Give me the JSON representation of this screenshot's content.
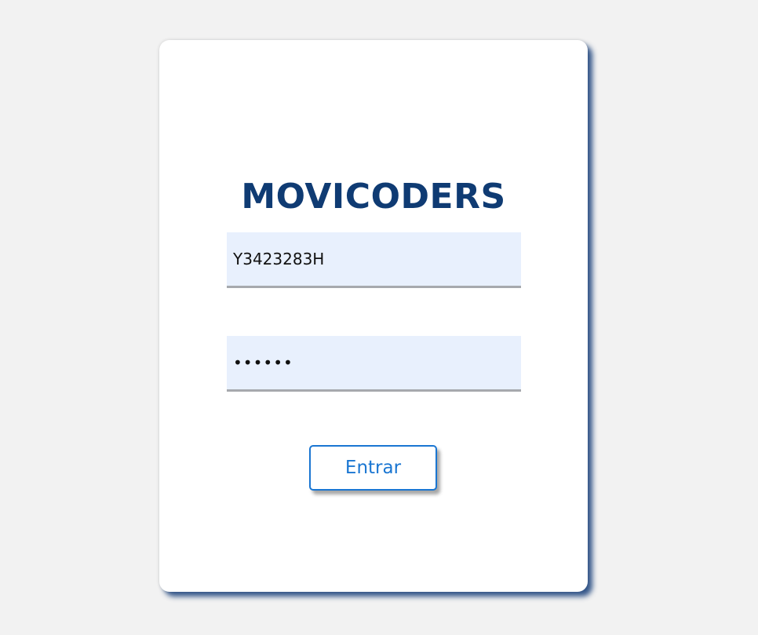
{
  "login": {
    "brand": "MOVICODERS",
    "username_value": "Y3423283H",
    "password_value": "123456",
    "submit_label": "Entrar"
  },
  "colors": {
    "background": "#f2f2f2",
    "brand": "#0f3b73",
    "input_bg": "#e8f0fd",
    "accent": "#1a76d2"
  }
}
